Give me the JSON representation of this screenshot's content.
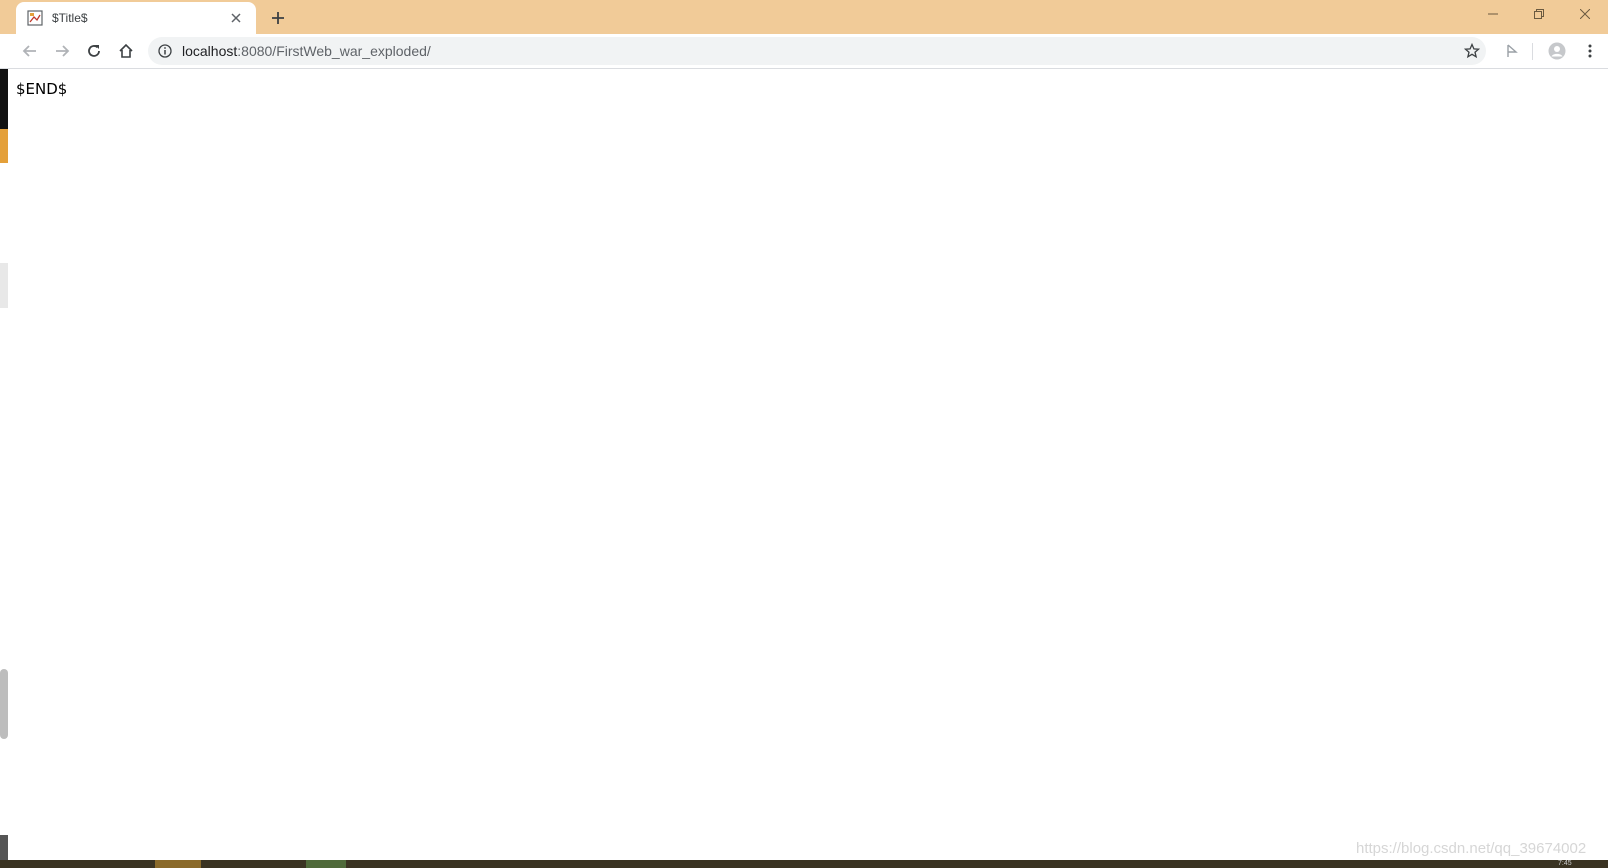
{
  "browser": {
    "tab": {
      "title": "$Title$"
    },
    "new_tab_label": "+",
    "window_controls": [
      "minimize",
      "restore",
      "close"
    ],
    "address_bar": {
      "host": "localhost",
      "path": ":8080/FirstWeb_war_exploded/"
    },
    "icons": {
      "back": "back-arrow-icon",
      "forward": "forward-arrow-icon",
      "reload": "reload-icon",
      "home": "home-icon",
      "info": "info-icon",
      "bookmark": "star-icon",
      "extension": "extension-icon",
      "profile": "profile-icon",
      "menu": "kebab-menu-icon"
    },
    "colors": {
      "tabstrip": "#f1cb98",
      "toolbar": "#ffffff",
      "omnibox": "#f1f3f4"
    }
  },
  "page": {
    "body_text": "$END$"
  },
  "watermark": "https://blog.csdn.net/qq_39674002",
  "taskbar": {
    "clock": "7:45"
  }
}
